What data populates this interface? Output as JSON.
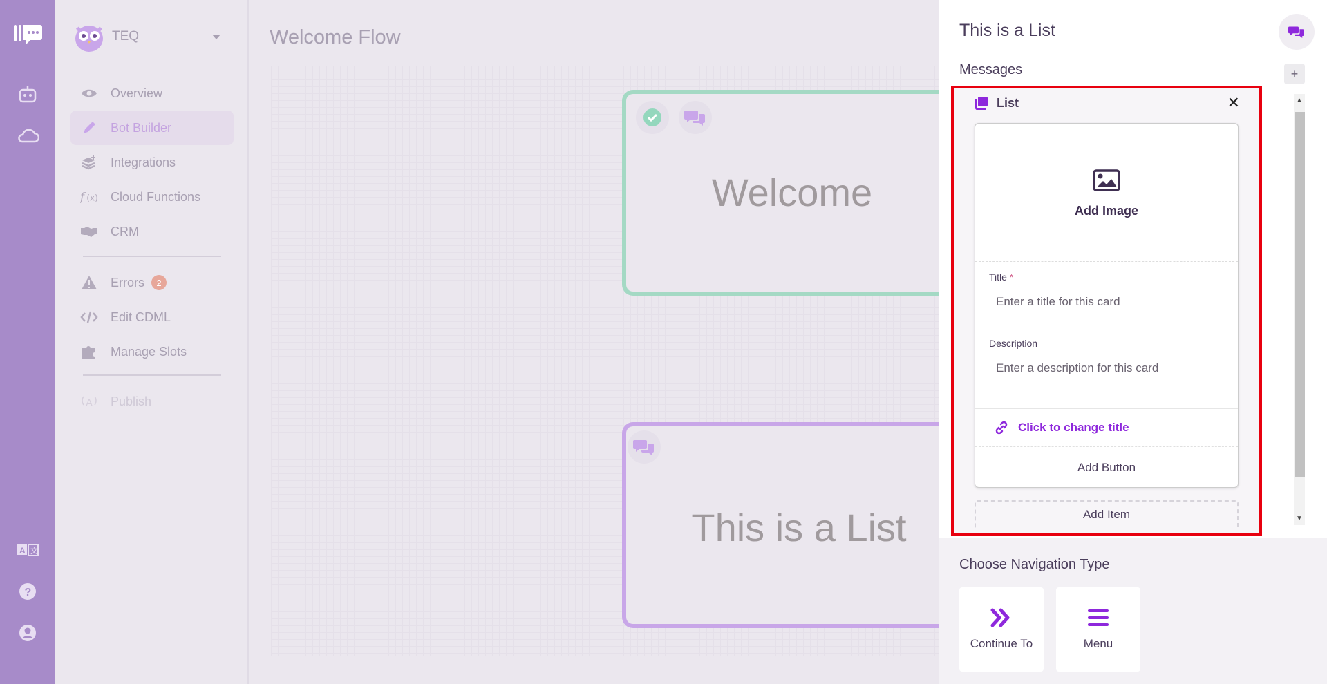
{
  "app": {
    "brand_name": "TEQ"
  },
  "sidebar": {
    "items": [
      {
        "label": "Overview",
        "icon": "eye-icon"
      },
      {
        "label": "Bot Builder",
        "icon": "pencil-icon",
        "active": true
      },
      {
        "label": "Integrations",
        "icon": "layers-plus-icon"
      },
      {
        "label": "Cloud Functions",
        "icon": "function-icon"
      },
      {
        "label": "CRM",
        "icon": "handshake-icon"
      },
      {
        "label": "Errors",
        "icon": "warning-icon",
        "badge": "2"
      },
      {
        "label": "Edit CDML",
        "icon": "code-icon"
      },
      {
        "label": "Manage Slots",
        "icon": "puzzle-icon"
      },
      {
        "label": "Publish",
        "icon": "broadcast-icon",
        "disabled": true
      }
    ]
  },
  "canvas": {
    "flow_title": "Welcome Flow",
    "nodes": [
      {
        "label": "Welcome"
      },
      {
        "label": "This is a List"
      }
    ]
  },
  "panel": {
    "title": "This is a List",
    "messages_heading": "Messages",
    "add_label": "+",
    "message": {
      "type_label": "List",
      "close_label": "✕",
      "card": {
        "add_image_label": "Add Image",
        "title_label": "Title",
        "required_mark": "*",
        "title_placeholder": "Enter a title for this card",
        "description_label": "Description",
        "description_placeholder": "Enter a description for this card",
        "link_label": "Click to change title",
        "add_button_label": "Add Button"
      },
      "add_item_label": "Add Item"
    },
    "navigation": {
      "heading": "Choose Navigation Type",
      "options": [
        {
          "label": "Continue To",
          "icon": "double-chevron-right-icon"
        },
        {
          "label": "Menu",
          "icon": "menu-icon"
        }
      ]
    }
  },
  "colors": {
    "rail": "#a78bc9",
    "accent": "#8e28dc",
    "welcome_border": "#a4d9c4",
    "list_border": "#c8a6e8",
    "highlight": "#e8000f"
  }
}
